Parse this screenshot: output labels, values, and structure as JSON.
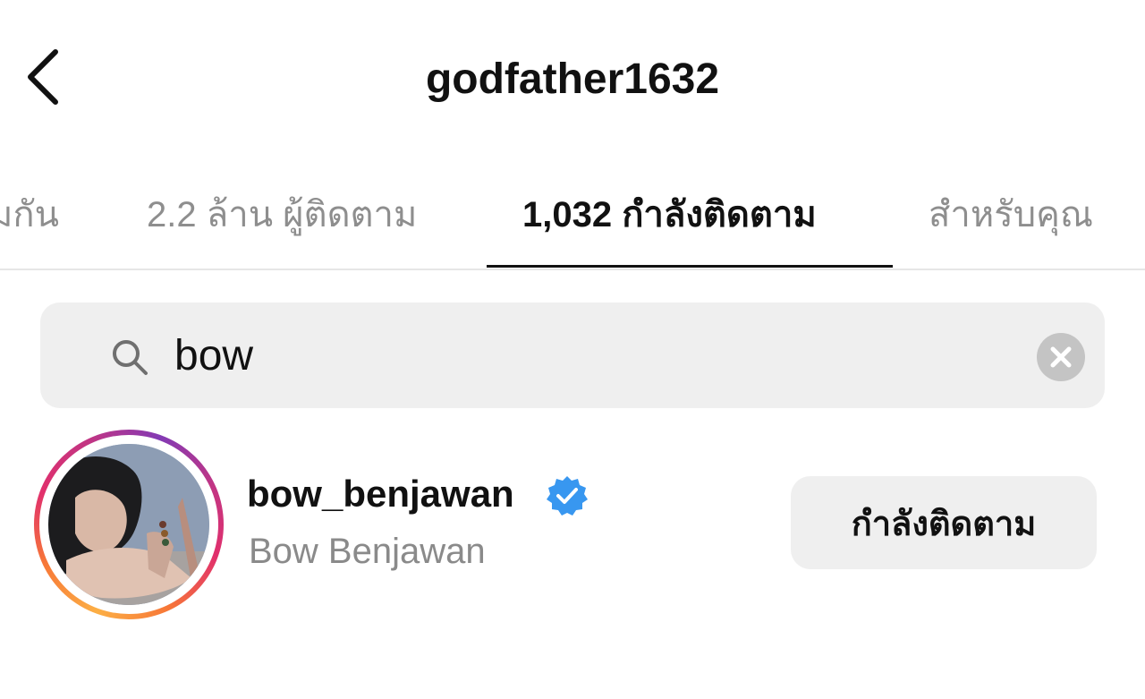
{
  "header": {
    "title": "godfather1632",
    "back_icon": "chevron-left-icon"
  },
  "tabs": [
    {
      "label": "มกัน",
      "active": false
    },
    {
      "label": "2.2 ล้าน ผู้ติดตาม",
      "active": false
    },
    {
      "label": "1,032 กำลังติดตาม",
      "active": true
    },
    {
      "label": "สำหรับคุณ",
      "active": false
    }
  ],
  "search": {
    "value": "bow",
    "search_icon": "search-icon",
    "clear_icon": "clear-icon"
  },
  "results": [
    {
      "username": "bow_benjawan",
      "verified": true,
      "full_name": "Bow Benjawan",
      "follow_label": "กำลังติดตาม"
    }
  ],
  "colors": {
    "verified_blue": "#3897f0",
    "inactive_text": "#8e8e8e",
    "search_bg": "#efefef",
    "button_bg": "#efefef"
  }
}
